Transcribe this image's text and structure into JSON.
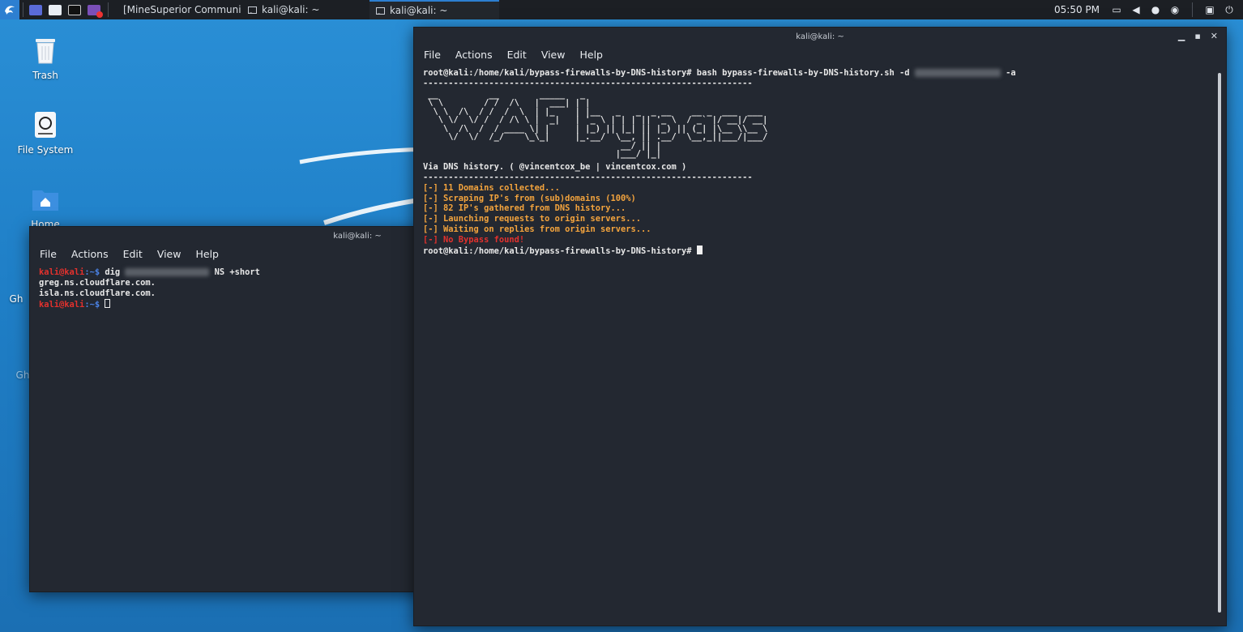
{
  "taskbar": {
    "tasks": [
      {
        "label": "[MineSuperior Communi..."
      },
      {
        "label": "kali@kali: ~"
      },
      {
        "label": "kali@kali: ~"
      }
    ],
    "clock": "05:50 PM"
  },
  "desktop": {
    "icons": [
      {
        "label": "Trash"
      },
      {
        "label": "File System"
      },
      {
        "label": "Home"
      },
      {
        "label": "Gh"
      },
      {
        "label": "Ghostchat..."
      }
    ]
  },
  "small_terminal": {
    "title": "kali@kali: ~",
    "menu": [
      "File",
      "Actions",
      "Edit",
      "View",
      "Help"
    ],
    "prompt_user": "kali@kali",
    "prompt_path": ":~$",
    "cmd_prefix": " dig ",
    "cmd_suffix": " NS +short",
    "output": [
      "greg.ns.cloudflare.com.",
      "isla.ns.cloudflare.com."
    ]
  },
  "big_terminal": {
    "title": "kali@kali: ~",
    "menu": [
      "File",
      "Actions",
      "Edit",
      "View",
      "Help"
    ],
    "command_prefix": "root@kali:/home/kali/bypass-firewalls-by-DNS-history# bash bypass-firewalls-by-DNS-history.sh -d ",
    "command_suffix": " -a",
    "divider": "-----------------------------------------------------------------",
    "ascii_art": [
      " __          __        _____   _                                    ",
      " \\ \\        / /  /\\   |  ___| | |                                   ",
      "  \\ \\  /\\  / /  /  \\  | |_    | |__   _   _  _ __    __ _  ___  ___ ",
      "   \\ \\/  \\/ /  / /\\ \\ |  _|   | '_ \\ | | | || '_ \\  / _` |/ __|/ __|",
      "    \\  /\\  /  / ____ \\| |     | |_) || |_| || |_) || (_| |\\__ \\\\__ \\",
      "     \\/  \\/  /_/    \\_\\_|     |_.__/  \\__, || .__/  \\__,_||___/|___/",
      "                                       __/ || |                       ",
      "                                      |___/ |_|                       "
    ],
    "credit": "Via DNS history. ( @vincentcox_be | vincentcox.com )",
    "status_lines": [
      "[-] 11 Domains collected...",
      "[-] Scraping IP's from (sub)domains (100%)",
      "[-] 82 IP's gathered from DNS history...",
      "[-] Launching requests to origin servers...",
      "[-] Waiting on replies from origin servers..."
    ],
    "result_line": "[-] No Bypass found!",
    "final_prompt": "root@kali:/home/kali/bypass-firewalls-by-DNS-history# "
  }
}
